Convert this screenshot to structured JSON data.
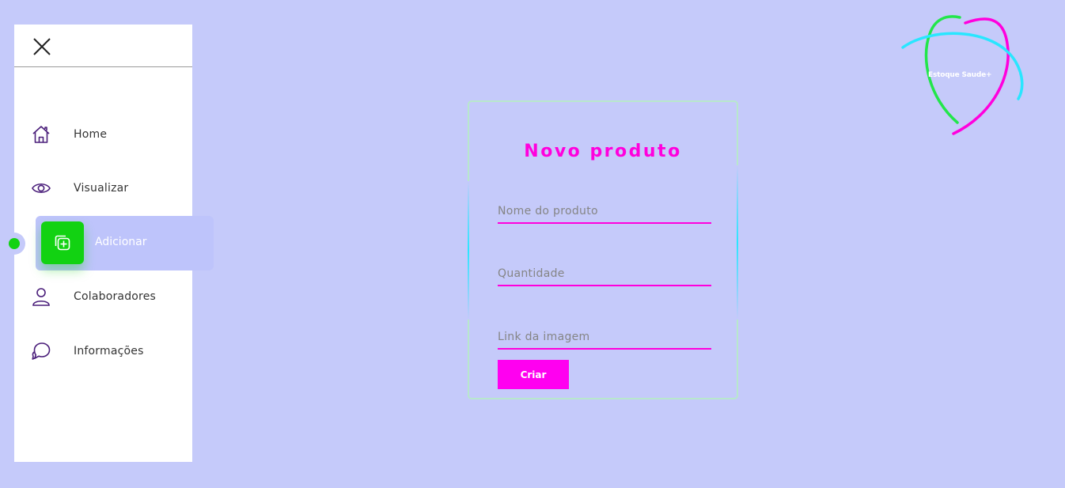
{
  "sidebar": {
    "items": [
      {
        "label": "Home",
        "icon": "home-icon"
      },
      {
        "label": "Visualizar",
        "icon": "eye-icon"
      },
      {
        "label": "Adicionar",
        "icon": "add-copy-icon",
        "active": true
      },
      {
        "label": "Colaboradores",
        "icon": "user-icon"
      },
      {
        "label": "Informações",
        "icon": "chat-icon"
      }
    ]
  },
  "form": {
    "title": "Novo produto",
    "fields": [
      {
        "placeholder": "Nome do produto",
        "value": ""
      },
      {
        "placeholder": "Quantidade",
        "value": ""
      },
      {
        "placeholder": "Link da imagem",
        "value": ""
      }
    ],
    "submit_label": "Criar"
  },
  "logo": {
    "text": "Estoque Saude+"
  },
  "colors": {
    "background": "#c5cafa",
    "accent_green": "#12d212",
    "accent_magenta": "#ff00dd",
    "accent_cyan": "#29e6ff",
    "active_bg": "#bec4fb"
  }
}
